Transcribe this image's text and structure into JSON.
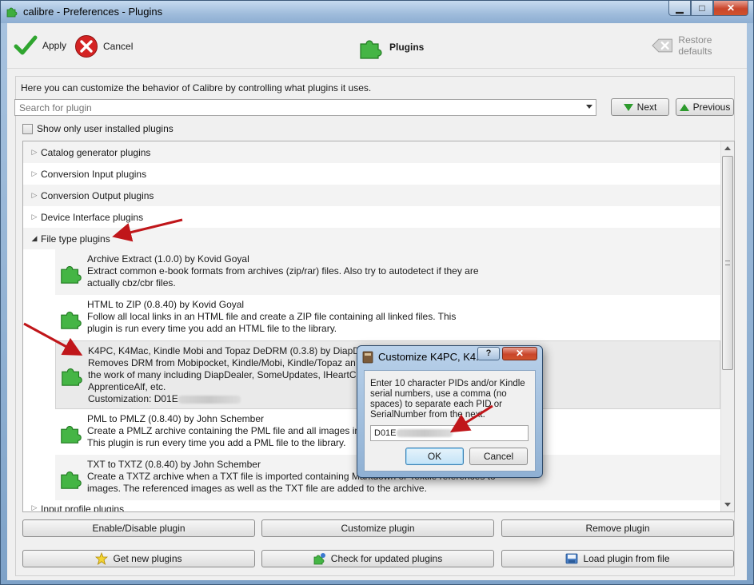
{
  "window": {
    "title": "calibre - Preferences - Plugins",
    "controls": {
      "minimize": "▁",
      "maximize": "□",
      "close": "✕"
    }
  },
  "toolbar": {
    "apply_label": "Apply",
    "cancel_label": "Cancel",
    "section_label": "Plugins",
    "restore_label": "Restore defaults"
  },
  "intro_text": "Here you can customize the behavior of Calibre by controlling what plugins it uses.",
  "search": {
    "placeholder": "Search for plugin",
    "next_label": "Next",
    "previous_label": "Previous"
  },
  "filter": {
    "user_only_label": "Show only user installed plugins",
    "checked": false
  },
  "categories": [
    {
      "label": "Catalog generator plugins",
      "expanded": false
    },
    {
      "label": "Conversion Input plugins",
      "expanded": false
    },
    {
      "label": "Conversion Output plugins",
      "expanded": false
    },
    {
      "label": "Device Interface plugins",
      "expanded": false
    },
    {
      "label": "File type plugins",
      "expanded": true
    },
    {
      "label": "Input profile plugins",
      "expanded": false
    }
  ],
  "file_type_plugins": [
    {
      "name": "Archive Extract (1.0.0) by Kovid Goyal",
      "desc1": "Extract common e-book formats from archives (zip/rar) files. Also try to autodetect if they are",
      "desc2": "actually cbz/cbr files."
    },
    {
      "name": "HTML to ZIP (0.8.40) by Kovid Goyal",
      "desc1": "Follow all local links in an HTML file and create a ZIP file containing all linked files. This",
      "desc2": "plugin is run every time you add an HTML file to the library."
    },
    {
      "name": "K4PC, K4Mac, Kindle Mobi and Topaz DeDRM (0.3.8) by DiapDea",
      "desc1": "Removes DRM from Mobipocket, Kindle/Mobi, Kindle/Topaz an",
      "desc2": "the work of many including DiapDealer, SomeUpdates, IHeartCa",
      "desc3": "ApprenticeAlf, etc.",
      "customization_label": "Customization: D01E",
      "selected": true
    },
    {
      "name": "PML to PMLZ (0.8.40) by John Schember",
      "desc1": "Create a PMLZ archive containing the PML file and all images in",
      "desc2": "This plugin is run every time you add a PML file to the library."
    },
    {
      "name": "TXT to TXTZ (0.8.40) by John Schember",
      "desc1": "Create a TXTZ archive when a TXT file is imported containing Markdown or Textile references to",
      "desc2": "images. The referenced images as well as the TXT file are added to the archive."
    }
  ],
  "actions_row1": {
    "enable_disable": "Enable/Disable plugin",
    "customize": "Customize plugin",
    "remove": "Remove plugin"
  },
  "actions_row2": {
    "get_new": "Get new plugins",
    "check_updates": "Check for updated plugins",
    "load_file": "Load plugin from file"
  },
  "dialog": {
    "title": "Customize K4PC, K4...",
    "help_label": "?",
    "close_label": "✕",
    "message": "Enter 10 character PIDs and/or Kindle serial numbers, use a comma (no spaces) to separate each PID or SerialNumber from the next.",
    "value_prefix": "D01E",
    "ok_label": "OK",
    "cancel_label": "Cancel"
  },
  "colors": {
    "accent_green": "#2d9a2d",
    "annotation_arrow": "#c0161a",
    "cancel_red": "#d42323"
  }
}
